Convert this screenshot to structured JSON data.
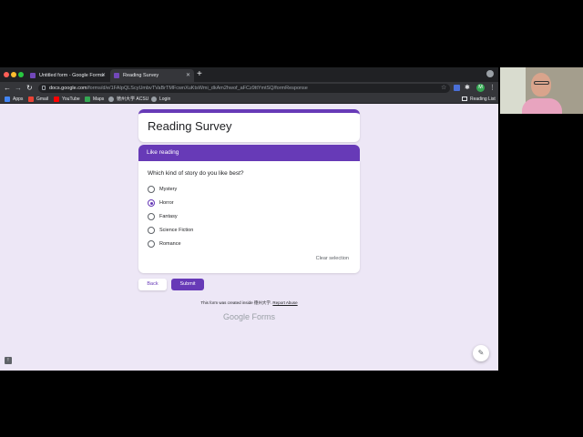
{
  "browser": {
    "tabs": [
      {
        "label": "Untitled form - Google Forms"
      },
      {
        "label": "Reading Survey"
      }
    ],
    "new_tab_icon": "plus-icon",
    "address": {
      "host": "docs.google.com",
      "path": "/forms/d/e/1FAIpQLScyUmbvTVaBrTMFcwnXuKtsWmi_dkAm2hwof_aFCz9ttYmtSQ/formResponse"
    },
    "bookmarks": [
      {
        "label": "Apps",
        "color": "#4285f4"
      },
      {
        "label": "Gmail",
        "color": "#ea4335"
      },
      {
        "label": "YouTube",
        "color": "#ff0000"
      },
      {
        "label": "Maps",
        "color": "#34a853"
      },
      {
        "label": "徳州大学 ACSU",
        "color": "#9aa0a6"
      },
      {
        "label": "Login",
        "color": "#9aa0a6"
      }
    ],
    "reading_list": "Reading List",
    "profile_initial": "M"
  },
  "form": {
    "title": "Reading Survey",
    "section_title": "Like reading",
    "question": "Which kind of story do you like best?",
    "options": [
      "Mystery",
      "Horror",
      "Fantasy",
      "Science Fiction",
      "Romance"
    ],
    "selected": "Horror",
    "clear_label": "Clear selection",
    "back_label": "Back",
    "submit_label": "Submit",
    "footer_text": "This form was created inside 徳州大学.",
    "report_label": "Report Abuse",
    "brand": "Google Forms",
    "accent_color": "#673ab7"
  }
}
